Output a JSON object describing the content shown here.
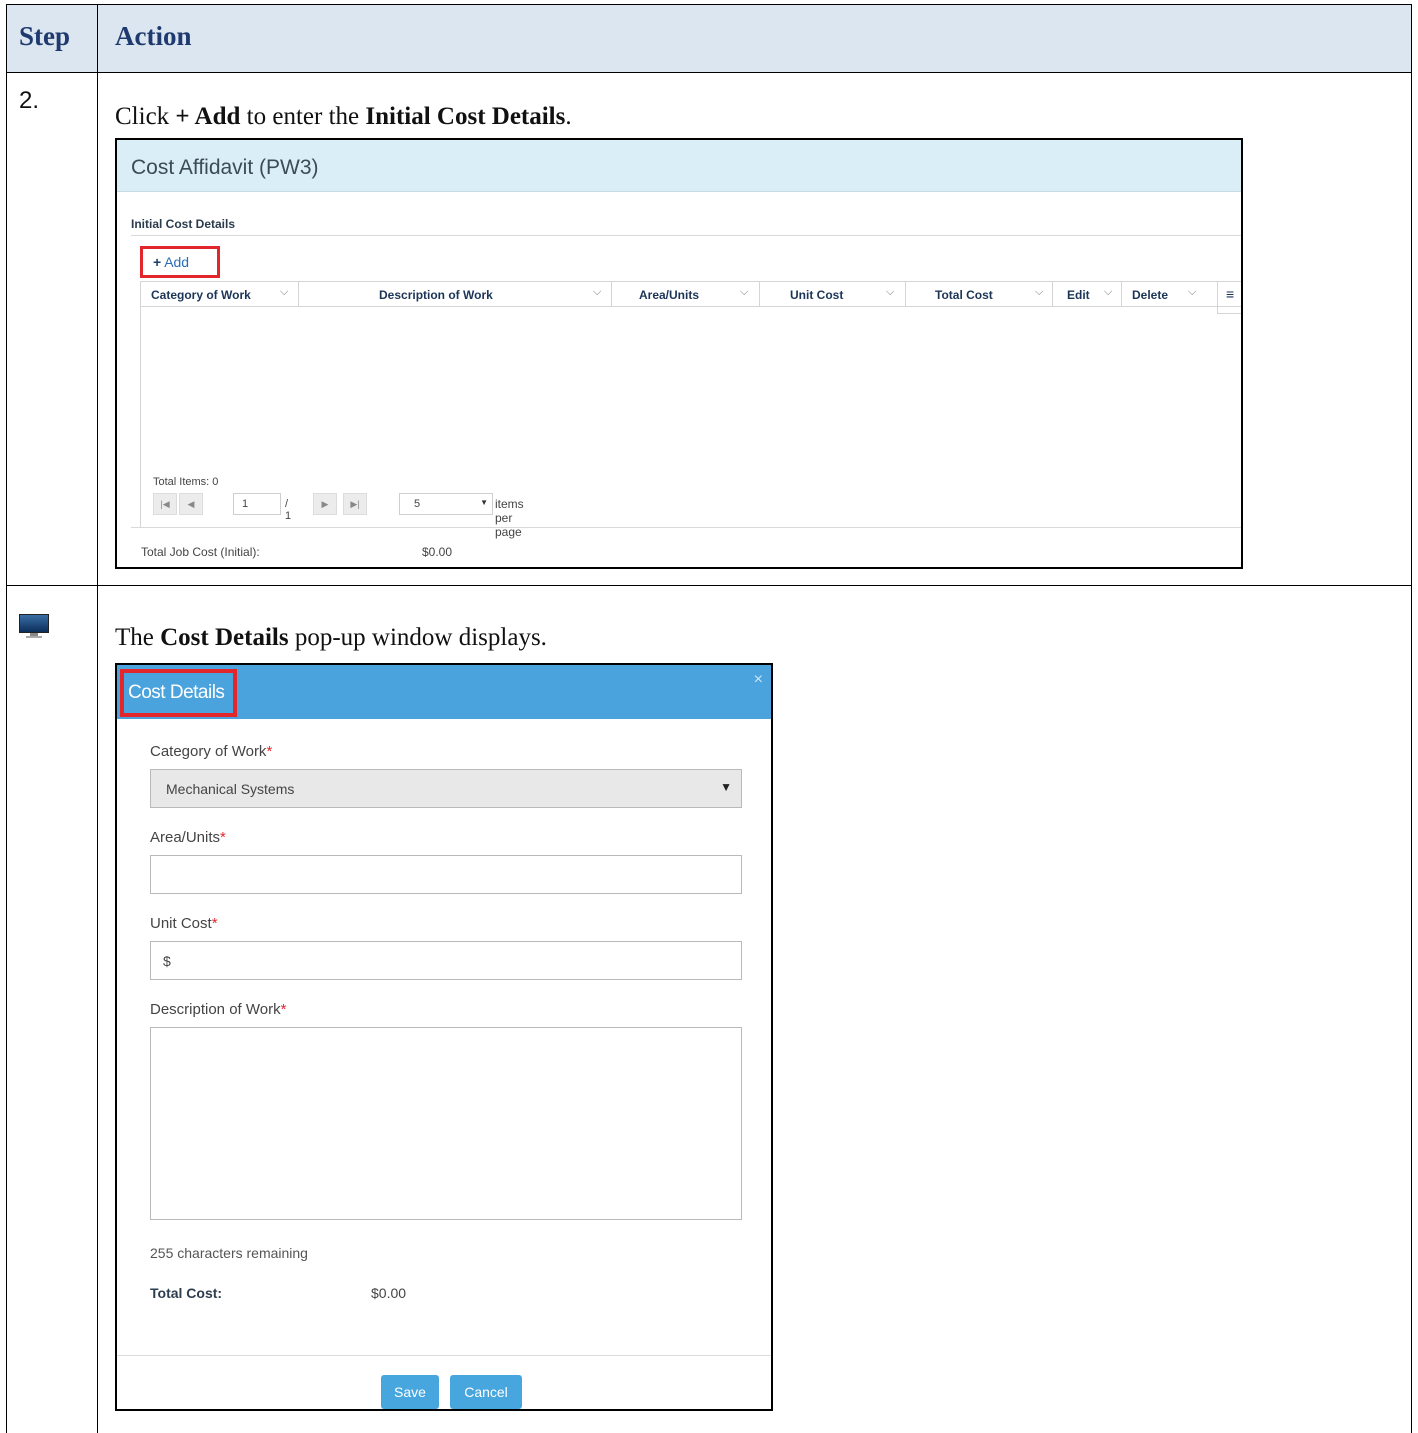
{
  "table": {
    "header_step": "Step",
    "header_action": "Action",
    "row1": {
      "step": "2.",
      "instr_click": "Click ",
      "instr_add": "+ Add",
      "instr_mid": " to enter the ",
      "instr_target": "Initial Cost Details",
      "instr_end": "."
    },
    "row2": {
      "step_icon": "monitor-icon",
      "instr_pre": "The ",
      "instr_target": "Cost Details",
      "instr_post": " pop-up window displays."
    }
  },
  "affidavit": {
    "title": "Cost Affidavit (PW3)",
    "section": "Initial Cost Details",
    "add_plus": "+",
    "add_label": "Add",
    "columns": [
      {
        "label": "Category of Work"
      },
      {
        "label": "Description of Work"
      },
      {
        "label": "Area/Units"
      },
      {
        "label": "Unit Cost"
      },
      {
        "label": "Total Cost"
      },
      {
        "label": "Edit"
      },
      {
        "label": "Delete"
      }
    ],
    "column_menu_icon": "≡",
    "total_items": "Total Items: 0",
    "pager": {
      "page": "1",
      "of": "/ 1",
      "page_size": "5",
      "items_per_page": "items per page"
    },
    "total_job_cost_label": "Total Job Cost (Initial):",
    "total_job_cost_value": "$0.00"
  },
  "modal": {
    "title": "Cost Details",
    "close": "×",
    "category_label": "Category of Work",
    "category_value": "Mechanical Systems",
    "area_label": "Area/Units",
    "area_value": "",
    "unit_cost_label": "Unit Cost",
    "unit_cost_value": "$",
    "description_label": "Description of Work",
    "description_value": "",
    "required_mark": "*",
    "chars_remaining": "255 characters remaining",
    "total_cost_label": "Total Cost:",
    "total_cost_value": "$0.00",
    "save_label": "Save",
    "cancel_label": "Cancel"
  },
  "colors": {
    "header_bg": "#dce6f0",
    "header_text": "#1f3a6e",
    "highlight": "#e3262c",
    "modal_title_bg": "#4aa3dc",
    "button_bg": "#48a6de"
  }
}
